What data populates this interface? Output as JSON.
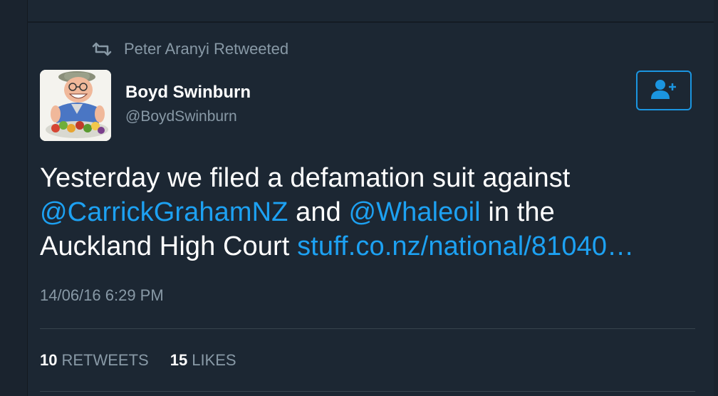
{
  "retweet_context": {
    "icon": "retweet-icon",
    "text": "Peter Aranyi Retweeted"
  },
  "author": {
    "name": "Boyd Swinburn",
    "handle": "@BoydSwinburn",
    "avatar": "avatar-caricature"
  },
  "follow_button": {
    "icon": "follow-user-icon",
    "color": "#1b95e0"
  },
  "tweet": {
    "line1": "Yesterday we filed a defamation suit against",
    "mention1": "@CarrickGrahamNZ",
    "and_text": " and ",
    "mention2": "@Whaleoil",
    "in_the_text": " in the",
    "line3_text": "Auckland High Court ",
    "link": "stuff.co.nz/national/81040…"
  },
  "timestamp": "14/06/16 6:29 PM",
  "stats": {
    "retweets_count": "10",
    "retweets_label": "RETWEETS",
    "likes_count": "15",
    "likes_label": "LIKES"
  },
  "colors": {
    "background": "#1c2733",
    "link": "#1da1f2",
    "muted": "#8899a6",
    "text": "#ffffff"
  }
}
